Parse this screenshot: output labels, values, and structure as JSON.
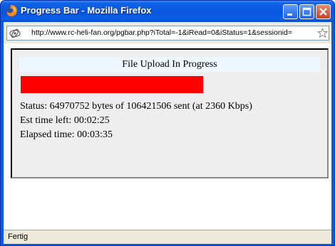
{
  "window": {
    "title": "Progress Bar - Mozilla Firefox"
  },
  "address_bar": {
    "url": "http://www.rc-heli-fan.org/pgbar.php?iTotal=-1&iRead=0&iStatus=1&sessionid="
  },
  "upload": {
    "heading": "File Upload In Progress",
    "progress_fraction": 0.61,
    "status_line": "Status: 64970752 bytes of 106421506 sent (at 2360 Kbps)",
    "est_time_line": "Est time left: 00:02:25",
    "elapsed_line": "Elapsed time: 00:03:35"
  },
  "status_bar": {
    "text": "Fertig"
  },
  "colors": {
    "progress_fill": "#ff0000",
    "titlebar": "#0a5be4"
  },
  "icons": [
    "firefox-icon",
    "minimize-icon",
    "maximize-icon",
    "close-icon",
    "site-identity-icon",
    "bookmark-star-icon"
  ]
}
